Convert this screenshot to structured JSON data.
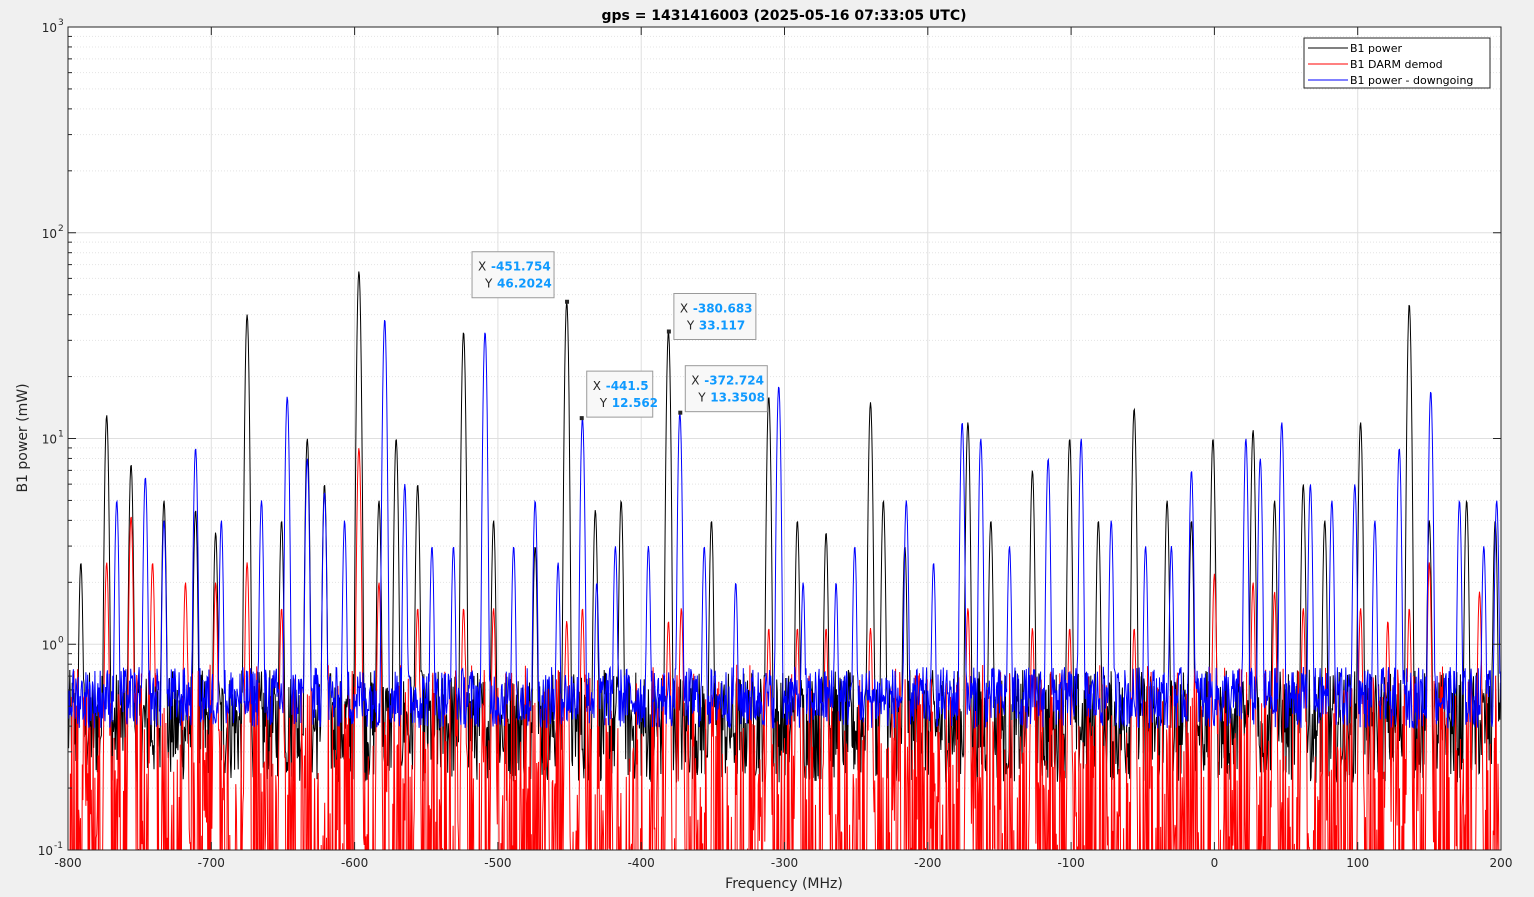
{
  "chart_data": {
    "type": "line",
    "title": "gps = 1431416003 (2025-05-16 07:33:05 UTC)",
    "xlabel": "Frequency (MHz)",
    "ylabel": "B1 power (mW)",
    "xlim": [
      -800,
      200
    ],
    "ylim": [
      0.1,
      1000
    ],
    "yscale": "log",
    "grid": true,
    "minor_grid": true,
    "legend_position": "top-right",
    "x_ticks": [
      -800,
      -700,
      -600,
      -500,
      -400,
      -300,
      -200,
      -100,
      0,
      100,
      200
    ],
    "x_tick_labels": [
      "-800",
      "-700",
      "-600",
      "-500",
      "-400",
      "-300",
      "-200",
      "-100",
      "0",
      "100",
      "200"
    ],
    "y_ticks": [
      {
        "value": 0.1,
        "base": "10",
        "exp": "-1"
      },
      {
        "value": 1,
        "base": "10",
        "exp": "0"
      },
      {
        "value": 10,
        "base": "10",
        "exp": "1"
      },
      {
        "value": 100,
        "base": "10",
        "exp": "2"
      },
      {
        "value": 1000,
        "base": "10",
        "exp": "3"
      }
    ],
    "series": [
      {
        "name": "B1 power",
        "color": "#000000",
        "floor": 0.4,
        "peaks": [
          [
            -791,
            2.5
          ],
          [
            -773,
            13
          ],
          [
            -756,
            7.5
          ],
          [
            -733,
            5
          ],
          [
            -711,
            4.5
          ],
          [
            -697,
            3.5
          ],
          [
            -675,
            40
          ],
          [
            -651,
            4
          ],
          [
            -633,
            10
          ],
          [
            -621,
            6
          ],
          [
            -597,
            65
          ],
          [
            -583,
            5
          ],
          [
            -571,
            10
          ],
          [
            -556,
            6
          ],
          [
            -524,
            33
          ],
          [
            -503,
            4
          ],
          [
            -474,
            3
          ],
          [
            -452,
            46.2024
          ],
          [
            -432,
            4.5
          ],
          [
            -414,
            5
          ],
          [
            -381,
            33.117
          ],
          [
            -351,
            4
          ],
          [
            -311,
            16
          ],
          [
            -291,
            4
          ],
          [
            -271,
            3.5
          ],
          [
            -240,
            15
          ],
          [
            -231,
            5
          ],
          [
            -216,
            3
          ],
          [
            -172,
            12
          ],
          [
            -156,
            4
          ],
          [
            -127,
            7
          ],
          [
            -101,
            10
          ],
          [
            -81,
            4
          ],
          [
            -56,
            14
          ],
          [
            -33,
            5
          ],
          [
            -1,
            10
          ],
          [
            -16,
            4
          ],
          [
            27,
            11
          ],
          [
            42,
            5
          ],
          [
            62,
            6
          ],
          [
            77,
            4
          ],
          [
            102,
            12
          ],
          [
            136,
            45
          ],
          [
            150,
            4
          ],
          [
            176,
            5
          ],
          [
            196,
            4
          ]
        ]
      },
      {
        "name": "B1 DARM demod",
        "color": "#ff0000",
        "floor": 0.2,
        "peaks": [
          [
            -773,
            2.5
          ],
          [
            -756,
            4.2
          ],
          [
            -741,
            2.5
          ],
          [
            -718,
            2
          ],
          [
            -697,
            2
          ],
          [
            -675,
            2.5
          ],
          [
            -651,
            1.5
          ],
          [
            -597,
            9
          ],
          [
            -583,
            2
          ],
          [
            -556,
            1.5
          ],
          [
            -524,
            1.5
          ],
          [
            -503,
            1.5
          ],
          [
            -452,
            1.3
          ],
          [
            -441,
            1.5
          ],
          [
            -381,
            1.3
          ],
          [
            -372,
            1.5
          ],
          [
            -311,
            1.2
          ],
          [
            -291,
            1.2
          ],
          [
            -271,
            1.2
          ],
          [
            -240,
            1.2
          ],
          [
            -172,
            1.5
          ],
          [
            -127,
            1.2
          ],
          [
            -101,
            1.2
          ],
          [
            -56,
            1.2
          ],
          [
            0,
            2.2
          ],
          [
            27,
            2
          ],
          [
            42,
            1.8
          ],
          [
            62,
            1.5
          ],
          [
            102,
            1.5
          ],
          [
            121,
            1.3
          ],
          [
            136,
            1.5
          ],
          [
            150,
            2.5
          ],
          [
            185,
            1.8
          ]
        ]
      },
      {
        "name": "B1 power - downgoing",
        "color": "#0000ff",
        "floor": 0.55,
        "peaks": [
          [
            -766,
            5
          ],
          [
            -746,
            6.5
          ],
          [
            -733,
            4
          ],
          [
            -711,
            9
          ],
          [
            -693,
            4
          ],
          [
            -665,
            5
          ],
          [
            -647,
            16
          ],
          [
            -633,
            8
          ],
          [
            -621,
            5.5
          ],
          [
            -607,
            4
          ],
          [
            -579,
            38
          ],
          [
            -565,
            6
          ],
          [
            -546,
            3
          ],
          [
            -531,
            3
          ],
          [
            -509,
            33
          ],
          [
            -489,
            3
          ],
          [
            -474,
            5
          ],
          [
            -458,
            2.5
          ],
          [
            -441,
            12.562
          ],
          [
            -431,
            2
          ],
          [
            -418,
            3
          ],
          [
            -395,
            3
          ],
          [
            -373,
            13.3508
          ],
          [
            -356,
            3
          ],
          [
            -334,
            2
          ],
          [
            -304,
            18
          ],
          [
            -287,
            2
          ],
          [
            -264,
            2
          ],
          [
            -251,
            3
          ],
          [
            -215,
            5
          ],
          [
            -196,
            2.5
          ],
          [
            -176,
            12
          ],
          [
            -163,
            10
          ],
          [
            -143,
            3
          ],
          [
            -116,
            8
          ],
          [
            -93,
            10
          ],
          [
            -72,
            4
          ],
          [
            -48,
            3
          ],
          [
            -30,
            3
          ],
          [
            -16,
            7
          ],
          [
            22,
            10
          ],
          [
            32,
            8
          ],
          [
            47,
            12
          ],
          [
            67,
            6
          ],
          [
            82,
            5
          ],
          [
            98,
            6
          ],
          [
            112,
            4
          ],
          [
            129,
            9
          ],
          [
            151,
            17
          ],
          [
            171,
            5
          ],
          [
            188,
            3
          ],
          [
            197,
            5
          ]
        ]
      }
    ],
    "legend": [
      "B1 power",
      "B1 DARM demod",
      "B1 power - downgoing"
    ],
    "annotations": [
      {
        "x": -451.754,
        "y": 46.2024,
        "x_label": "X",
        "y_label": "Y",
        "x_text": "-451.754",
        "y_text": "46.2024"
      },
      {
        "x": -380.683,
        "y": 33.117,
        "x_label": "X",
        "y_label": "Y",
        "x_text": "-380.683",
        "y_text": "33.117"
      },
      {
        "x": -441.5,
        "y": 12.562,
        "x_label": "X",
        "y_label": "Y",
        "x_text": "-441.5",
        "y_text": "12.562"
      },
      {
        "x": -372.724,
        "y": 13.3508,
        "x_label": "X",
        "y_label": "Y",
        "x_text": "-372.724",
        "y_text": "13.3508"
      }
    ]
  }
}
